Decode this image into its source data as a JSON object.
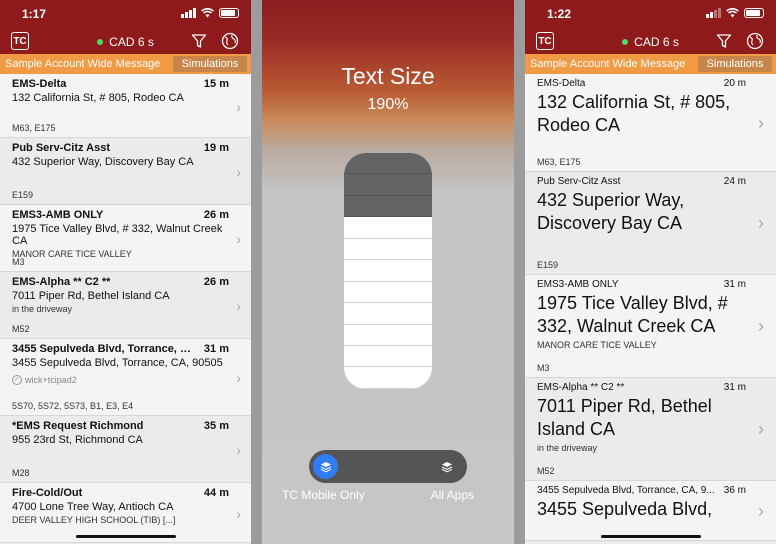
{
  "left": {
    "time": "1:17",
    "cad_label": "CAD 6 s",
    "logo": "TC",
    "message": "Sample Account Wide Message",
    "simulations": "Simulations",
    "rows": [
      {
        "title": "EMS-Delta",
        "dist": "15 m",
        "addr": "132 California St, # 805, Rodeo CA",
        "note": "",
        "units": "M63, E175",
        "h": 64
      },
      {
        "title": "Pub Serv-Citz Asst",
        "dist": "19 m",
        "addr": "432 Superior Way, Discovery Bay CA",
        "note": "",
        "units": "E159",
        "h": 67
      },
      {
        "title": "EMS3-AMB ONLY",
        "dist": "26 m",
        "addr": "1975 Tice Valley Blvd, # 332, Walnut Creek CA",
        "note": "MANOR CARE TICE VALLEY",
        "units": "M3",
        "h": 67
      },
      {
        "title": "EMS-Alpha ** C2 **",
        "dist": "26 m",
        "addr": "7011 Piper Rd, Bethel Island CA",
        "note": "in the driveway",
        "units": "M52",
        "h": 67
      },
      {
        "title": "3455 Sepulveda Blvd, Torrance, CA, 90...",
        "dist": "31 m",
        "addr": "3455 Sepulveda Blvd, Torrance, CA, 90505",
        "note": "",
        "assigned": "wick+tcipad2",
        "units": "5S70, 5S72, 5S73, B1, E3, E4",
        "h": 77
      },
      {
        "title": "*EMS Request Richmond",
        "dist": "35 m",
        "addr": "955 23rd St, Richmond CA",
        "note": "",
        "units": "M28",
        "h": 67
      },
      {
        "title": "Fire-Cold/Out",
        "dist": "44 m",
        "addr": "4700 Lone Tree Way, Antioch CA",
        "note": "DEER VALLEY HIGH SCHOOL (TIB) [...]",
        "units": "",
        "h": 60
      }
    ]
  },
  "middle": {
    "title": "Text Size",
    "value": "190%",
    "segments_total": 11,
    "segments_on": 3,
    "scope_left": "TC Mobile Only",
    "scope_right": "All Apps"
  },
  "right": {
    "time": "1:22",
    "cad_label": "CAD 6 s",
    "logo": "TC",
    "message": "Sample Account Wide Message",
    "simulations": "Simulations",
    "rows": [
      {
        "title": "EMS-Delta",
        "dist": "20 m",
        "addr": "132 California St, # 805, Rodeo CA",
        "note": "",
        "units": "M63, E175",
        "h": 98
      },
      {
        "title": "Pub Serv-Citz Asst",
        "dist": "24 m",
        "addr": "432 Superior Way, Discovery Bay CA",
        "note": "",
        "units": "E159",
        "h": 103
      },
      {
        "title": "EMS3-AMB ONLY",
        "dist": "31 m",
        "addr": "1975 Tice Valley Blvd, # 332, Walnut Creek CA",
        "note": "MANOR CARE TICE VALLEY",
        "units": "M3",
        "h": 103
      },
      {
        "title": "EMS-Alpha ** C2 **",
        "dist": "31 m",
        "addr": "7011 Piper Rd, Bethel Island CA",
        "note": "in the driveway",
        "units": "M52",
        "h": 103
      },
      {
        "title": "3455 Sepulveda Blvd, Torrance, CA, 9...",
        "dist": "36 m",
        "addr": "3455 Sepulveda Blvd,",
        "note": "",
        "units": "",
        "h": 60
      }
    ]
  },
  "colors": {
    "header": "#8e1a1c",
    "message_bar": "#f09a45",
    "toggle_active": "#2f7cf6"
  }
}
